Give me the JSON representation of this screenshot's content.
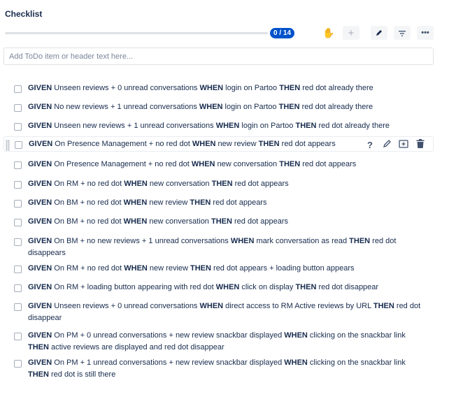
{
  "checklist": {
    "title": "Checklist",
    "progress": {
      "label": "0 / 14",
      "done": 0,
      "total": 14
    }
  },
  "add_input": {
    "placeholder": "Add ToDo item or header text here..."
  },
  "items": [
    [
      {
        "t": "GIVEN",
        "b": 1
      },
      {
        "t": " Unseen reviews + 0 unread conversations "
      },
      {
        "t": "WHEN",
        "b": 1
      },
      {
        "t": " login on Partoo "
      },
      {
        "t": "THEN",
        "b": 1
      },
      {
        "t": " red dot already there"
      }
    ],
    [
      {
        "t": "GIVEN",
        "b": 1
      },
      {
        "t": " No new reviews + 1 unread conversations "
      },
      {
        "t": "WHEN",
        "b": 1
      },
      {
        "t": " login on Partoo "
      },
      {
        "t": "THEN",
        "b": 1
      },
      {
        "t": " red dot already there"
      }
    ],
    [
      {
        "t": "GIVEN",
        "b": 1
      },
      {
        "t": " Unseen new reviews + 1 unread conversations "
      },
      {
        "t": "WHEN",
        "b": 1
      },
      {
        "t": " login on Partoo "
      },
      {
        "t": "THEN",
        "b": 1
      },
      {
        "t": " red dot already there"
      }
    ],
    [
      {
        "t": "GIVEN",
        "b": 1
      },
      {
        "t": " On Presence Management + no red dot "
      },
      {
        "t": "WHEN",
        "b": 1
      },
      {
        "t": " new review "
      },
      {
        "t": "THEN",
        "b": 1
      },
      {
        "t": " red dot appears"
      }
    ],
    [
      {
        "t": "GIVEN",
        "b": 1
      },
      {
        "t": " On Presence Management + no red dot "
      },
      {
        "t": "WHEN",
        "b": 1
      },
      {
        "t": " new conversation "
      },
      {
        "t": "THEN",
        "b": 1
      },
      {
        "t": " red dot appears"
      }
    ],
    [
      {
        "t": "GIVEN",
        "b": 1
      },
      {
        "t": " On RM + no red dot "
      },
      {
        "t": "WHEN",
        "b": 1
      },
      {
        "t": " new conversation "
      },
      {
        "t": "THEN",
        "b": 1
      },
      {
        "t": " red dot appears"
      }
    ],
    [
      {
        "t": "GIVEN",
        "b": 1
      },
      {
        "t": " On BM + no red dot "
      },
      {
        "t": "WHEN",
        "b": 1
      },
      {
        "t": " new review "
      },
      {
        "t": "THEN",
        "b": 1
      },
      {
        "t": " red dot appears"
      }
    ],
    [
      {
        "t": "GIVEN",
        "b": 1
      },
      {
        "t": " On BM + no red dot "
      },
      {
        "t": "WHEN",
        "b": 1
      },
      {
        "t": " new conversation "
      },
      {
        "t": "THEN",
        "b": 1
      },
      {
        "t": " red dot appears"
      }
    ],
    [
      {
        "t": "GIVEN",
        "b": 1
      },
      {
        "t": " On BM + no new reviews + 1 unread conversations "
      },
      {
        "t": "WHEN",
        "b": 1
      },
      {
        "t": " mark conversation as read "
      },
      {
        "t": "THEN",
        "b": 1
      },
      {
        "t": " red dot disappears"
      }
    ],
    [
      {
        "t": "GIVEN",
        "b": 1
      },
      {
        "t": " On RM + no red dot "
      },
      {
        "t": "WHEN",
        "b": 1
      },
      {
        "t": " new review "
      },
      {
        "t": "THEN",
        "b": 1
      },
      {
        "t": " red dot appears + loading button appears"
      }
    ],
    [
      {
        "t": "GIVEN",
        "b": 1
      },
      {
        "t": " On RM + loading button appearing with red dot "
      },
      {
        "t": "WHEN",
        "b": 1
      },
      {
        "t": " click on display "
      },
      {
        "t": "THEN",
        "b": 1
      },
      {
        "t": " red dot disappear"
      }
    ],
    [
      {
        "t": "GIVEN",
        "b": 1
      },
      {
        "t": " Unseen reviews + 0 unread conversations "
      },
      {
        "t": "WHEN",
        "b": 1
      },
      {
        "t": " direct access to RM Active reviews by URL "
      },
      {
        "t": "THEN",
        "b": 1
      },
      {
        "t": " red dot disappear"
      }
    ],
    [
      {
        "t": "GIVEN",
        "b": 1
      },
      {
        "t": " On PM + 0 unread conversations + new review snackbar displayed "
      },
      {
        "t": "WHEN",
        "b": 1
      },
      {
        "t": " clicking on the snackbar link "
      },
      {
        "t": "THEN",
        "b": 1
      },
      {
        "t": " active reviews are displayed and red dot disappear"
      }
    ],
    [
      {
        "t": "GIVEN",
        "b": 1
      },
      {
        "t": " On PM + 1 unread conversations + new review snackbar displayed "
      },
      {
        "t": "WHEN",
        "b": 1
      },
      {
        "t": " clicking on the snackbar link "
      },
      {
        "t": "THEN",
        "b": 1
      },
      {
        "t": " red dot is still there"
      }
    ]
  ],
  "hovered_item_index": 3,
  "toolbar_icons": [
    "hand-icon",
    "plus-icon",
    "pencil-icon",
    "filter-icon",
    "more-icon"
  ],
  "row_action_icons": [
    "help-icon",
    "edit-icon",
    "convert-icon",
    "delete-icon"
  ],
  "colors": {
    "accent": "#0052cc",
    "text": "#172b4d",
    "border": "#dfe1e6",
    "hand": "#ffab00"
  }
}
